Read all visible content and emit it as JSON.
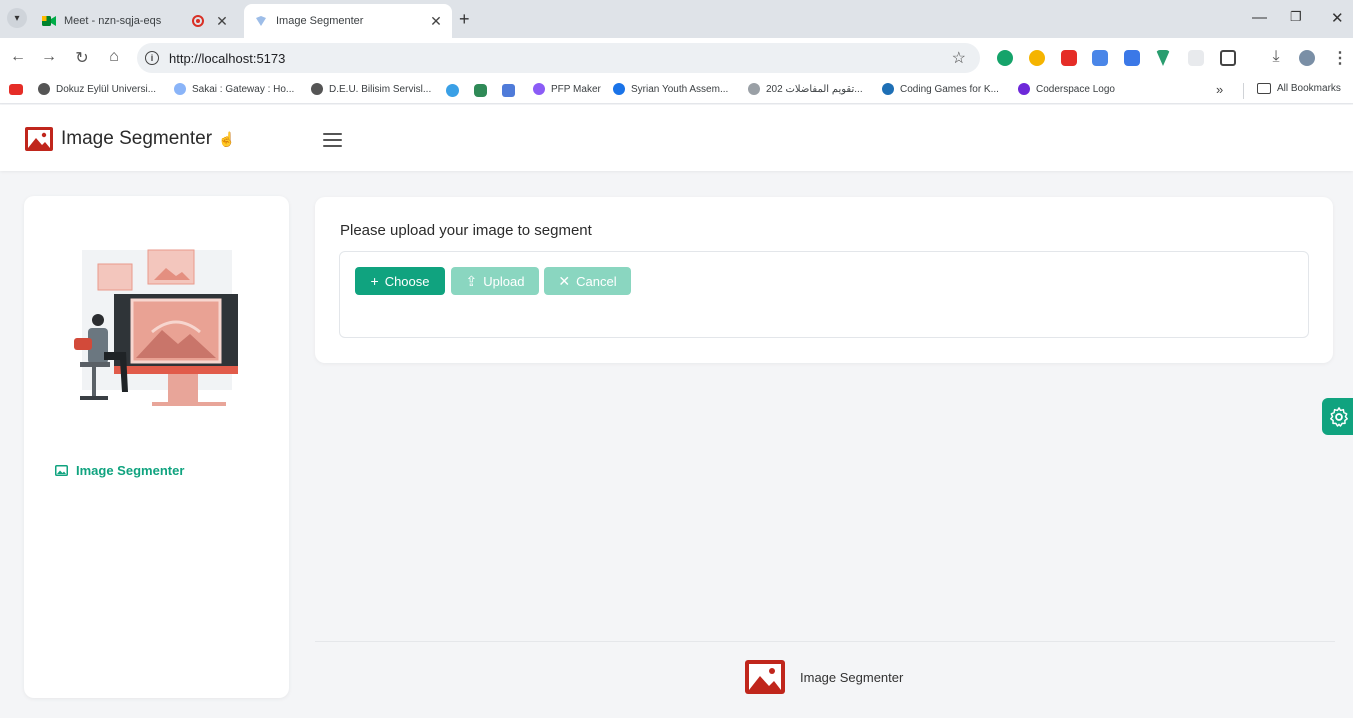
{
  "browser": {
    "tabs": [
      {
        "title": "Meet - nzn-sqja-eqs",
        "active": false,
        "recording": true
      },
      {
        "title": "Image Segmenter",
        "active": true
      }
    ],
    "address": {
      "url": "http://localhost:5173"
    },
    "bookmarks": [
      {
        "label": "Dokuz Eylül Universi...",
        "icon": "globe-icon"
      },
      {
        "label": "Sakai : Gateway : Ho...",
        "icon": "sakai-icon"
      },
      {
        "label": "D.E.U. Bilisim Servisl...",
        "icon": "globe-icon"
      },
      {
        "label": "PFP Maker",
        "icon": "pfp-icon"
      },
      {
        "label": "Syrian Youth Assem...",
        "icon": "g-icon"
      },
      {
        "label": "تقويم المفاضلات 202...",
        "icon": "calendar-icon"
      },
      {
        "label": "Coding Games for K...",
        "icon": "coding-icon"
      },
      {
        "label": "Coderspace Logo",
        "icon": "coderspace-icon"
      }
    ],
    "all_bookmarks_label": "All Bookmarks"
  },
  "app": {
    "brand": "Image Segmenter",
    "sidebar": {
      "items": [
        {
          "label": "Image Segmenter",
          "icon": "image-icon",
          "active": true
        }
      ]
    },
    "upload": {
      "title": "Please upload your image to segment",
      "choose_label": "Choose",
      "upload_label": "Upload",
      "cancel_label": "Cancel"
    },
    "footer": {
      "label": "Image Segmenter"
    }
  },
  "colors": {
    "accent": "#10a37f",
    "accent_disabled": "#8ad6c0",
    "logo_red": "#c0261c"
  }
}
